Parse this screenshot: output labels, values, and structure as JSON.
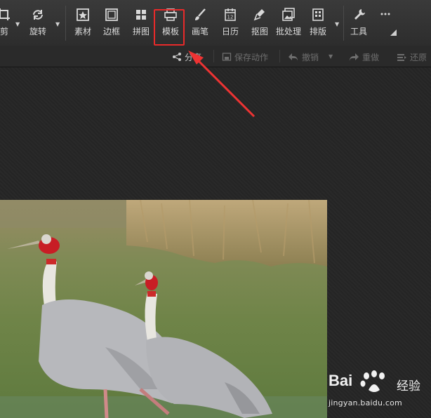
{
  "toolbar": {
    "items": [
      {
        "label": "剪",
        "icon": "crop-icon"
      },
      {
        "label": "旋转",
        "icon": "rotate-icon"
      },
      {
        "label": "素材",
        "icon": "star-icon"
      },
      {
        "label": "边框",
        "icon": "frame-icon"
      },
      {
        "label": "拼图",
        "icon": "grid-icon"
      },
      {
        "label": "模板",
        "icon": "template-icon"
      },
      {
        "label": "画笔",
        "icon": "brush-icon"
      },
      {
        "label": "日历",
        "icon": "calendar-icon"
      },
      {
        "label": "抠图",
        "icon": "pen-icon"
      },
      {
        "label": "批处理",
        "icon": "batch-icon"
      },
      {
        "label": "排版",
        "icon": "layout-icon"
      },
      {
        "label": "工具",
        "icon": "wrench-icon"
      },
      {
        "label": "",
        "icon": "more-icon"
      }
    ],
    "calendar_day": "12"
  },
  "actions": {
    "share": "分享",
    "save_action": "保存动作",
    "undo": "撤销",
    "redo": "重做",
    "restore": "还原"
  },
  "watermark": {
    "brand": "Bai",
    "brand_tail": "经验",
    "url": "jingyan.baidu.com"
  },
  "colors": {
    "highlight": "#e82a2a",
    "toolbar_bg": "#333333",
    "canvas_bg": "#252525"
  }
}
